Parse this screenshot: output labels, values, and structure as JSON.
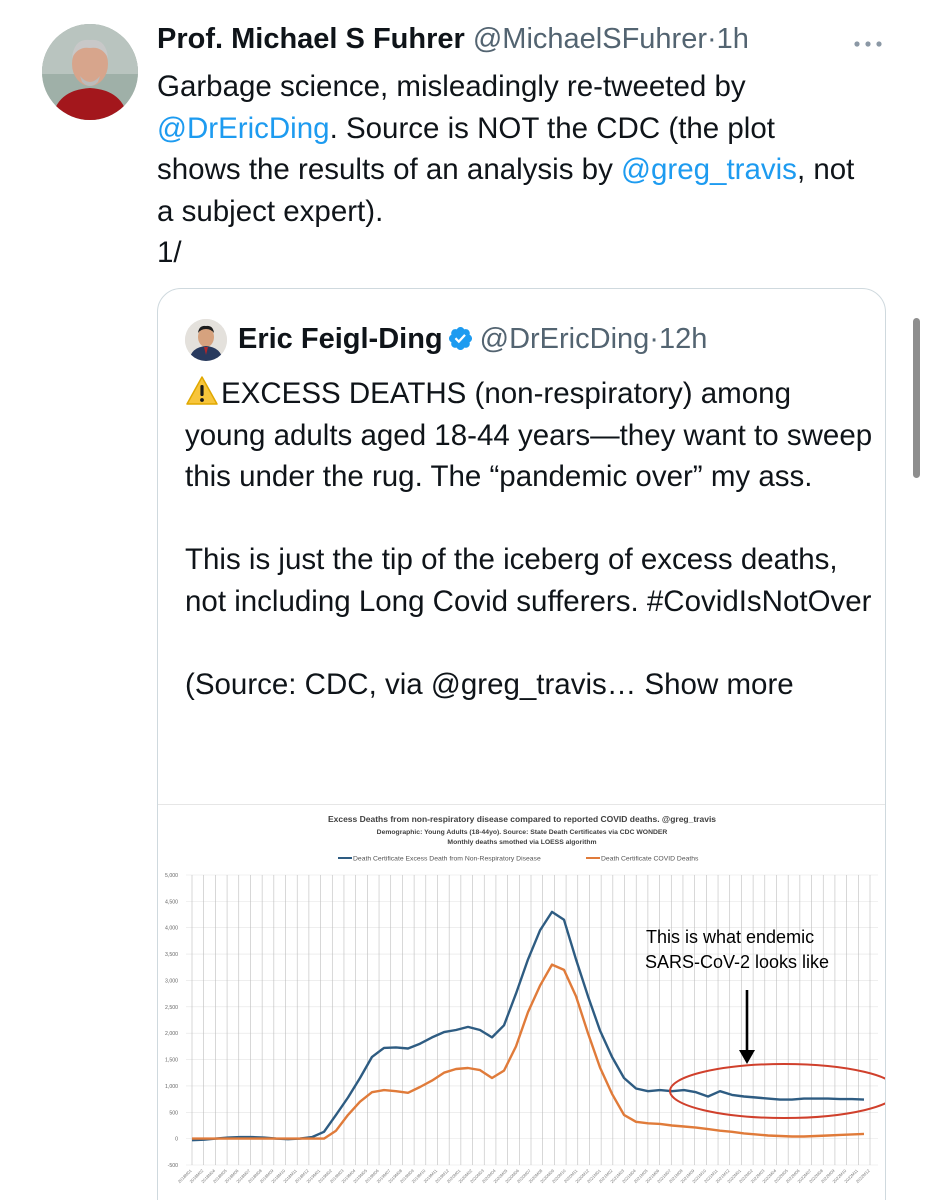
{
  "tweet": {
    "author_name": "Prof. Michael S Fuhrer",
    "author_handle": "@MichaelSFuhrer",
    "separator": "·",
    "time": "1h",
    "more_icon": "more-dots-icon",
    "text": {
      "part1": "Garbage science, misleadingly re-tweeted by ",
      "mention1": "@DrEricDing",
      "part2": ". Source is NOT the CDC (the plot shows the results of an analysis by ",
      "mention2": "@greg_travis",
      "part3": ", not a subject expert).",
      "thread": "1/"
    }
  },
  "quote": {
    "author_name": "Eric Feigl-Ding",
    "author_handle": "@DrEricDing",
    "separator": "·",
    "time": "12h",
    "verified_icon": "verified-badge-icon",
    "warning_icon": "warning-icon",
    "para1": "EXCESS DEATHS (non-respiratory) among young adults aged 18-44 years—they want to sweep this under the rug. The “pandemic over” my ass.",
    "para2": "This is just the tip of the iceberg of excess deaths, not including Long Covid sufferers. #CovidIsNotOver",
    "para3_text": "(Source: CDC, via @greg_travis… ",
    "show_more": "Show more"
  },
  "colors": {
    "link": "#1d9bf0",
    "excess_line": "#2e5c82",
    "covid_line": "#e07b3a",
    "annotation_ellipse": "#d0402c"
  },
  "chart_data": {
    "type": "line",
    "title": "Excess Deaths from non-respiratory disease compared to reported COVID deaths.  @greg_travis",
    "subtitle1": "Demographic: Young Adults (18-44yo).  Source: State Death Certificates via CDC WONDER",
    "subtitle2": "Monthly deaths smothed via LOESS algorithm",
    "legend_position": "top",
    "grid": true,
    "ylim": [
      -500,
      5000
    ],
    "yticks": [
      "5,000",
      "4,500",
      "4,000",
      "3,500",
      "3,000",
      "2,500",
      "2,000",
      "1,500",
      "1,000",
      "500",
      "0",
      "-500"
    ],
    "x_tick_labels": [
      "2018M01",
      "2018M02",
      "2018M04",
      "2018M05",
      "2018M06",
      "2018M07",
      "2018M08",
      "2018M09",
      "2018M10",
      "2018M11",
      "2018M12",
      "2019M01",
      "2019M02",
      "2019M03",
      "2019M04",
      "2019M05",
      "2019M06",
      "2019M07",
      "2019M08",
      "2019M09",
      "2019M10",
      "2019M11",
      "2019M12",
      "2020M01",
      "2020M02",
      "2020M03",
      "2020M04",
      "2020M05",
      "2020M06",
      "2020M07",
      "2020M08",
      "2020M09",
      "2020M10",
      "2020M11",
      "2020M12",
      "2021M01",
      "2021M02",
      "2021M03",
      "2021M04",
      "2021M05",
      "2021M06",
      "2021M07",
      "2021M08",
      "2021M09",
      "2021M10",
      "2021M11",
      "2021M12",
      "2022M01",
      "2022M02",
      "2022M03",
      "2022M04",
      "2022M05",
      "2022M06",
      "2022M07",
      "2022M08",
      "2022M09",
      "2022M10",
      "2022M11",
      "2022M12"
    ],
    "series": [
      {
        "name": "Death Certificate Excess Death from Non-Respiratory Disease",
        "color": "#2e5c82",
        "values": [
          -30,
          -20,
          0,
          20,
          30,
          30,
          20,
          0,
          -10,
          0,
          30,
          130,
          450,
          780,
          1150,
          1550,
          1720,
          1730,
          1710,
          1800,
          1920,
          2020,
          2060,
          2120,
          2060,
          1920,
          2150,
          2750,
          3400,
          3950,
          4300,
          4150,
          3400,
          2700,
          2050,
          1550,
          1150,
          950,
          900,
          920,
          900,
          920,
          880,
          800,
          900,
          830,
          800,
          780,
          760,
          740,
          740,
          760,
          760,
          760,
          750,
          750,
          740
        ]
      },
      {
        "name": "Death Certificate COVID Deaths",
        "color": "#e07b3a",
        "values": [
          0,
          0,
          0,
          0,
          0,
          0,
          0,
          0,
          0,
          0,
          0,
          0,
          150,
          450,
          700,
          880,
          920,
          900,
          870,
          980,
          1100,
          1250,
          1320,
          1340,
          1300,
          1150,
          1290,
          1750,
          2400,
          2900,
          3300,
          3200,
          2700,
          2000,
          1350,
          850,
          450,
          320,
          290,
          280,
          250,
          230,
          210,
          180,
          150,
          130,
          100,
          80,
          60,
          50,
          40,
          40,
          50,
          60,
          70,
          80,
          90
        ]
      }
    ],
    "annotation": "This is what endemic SARS-CoV-2 looks like"
  }
}
